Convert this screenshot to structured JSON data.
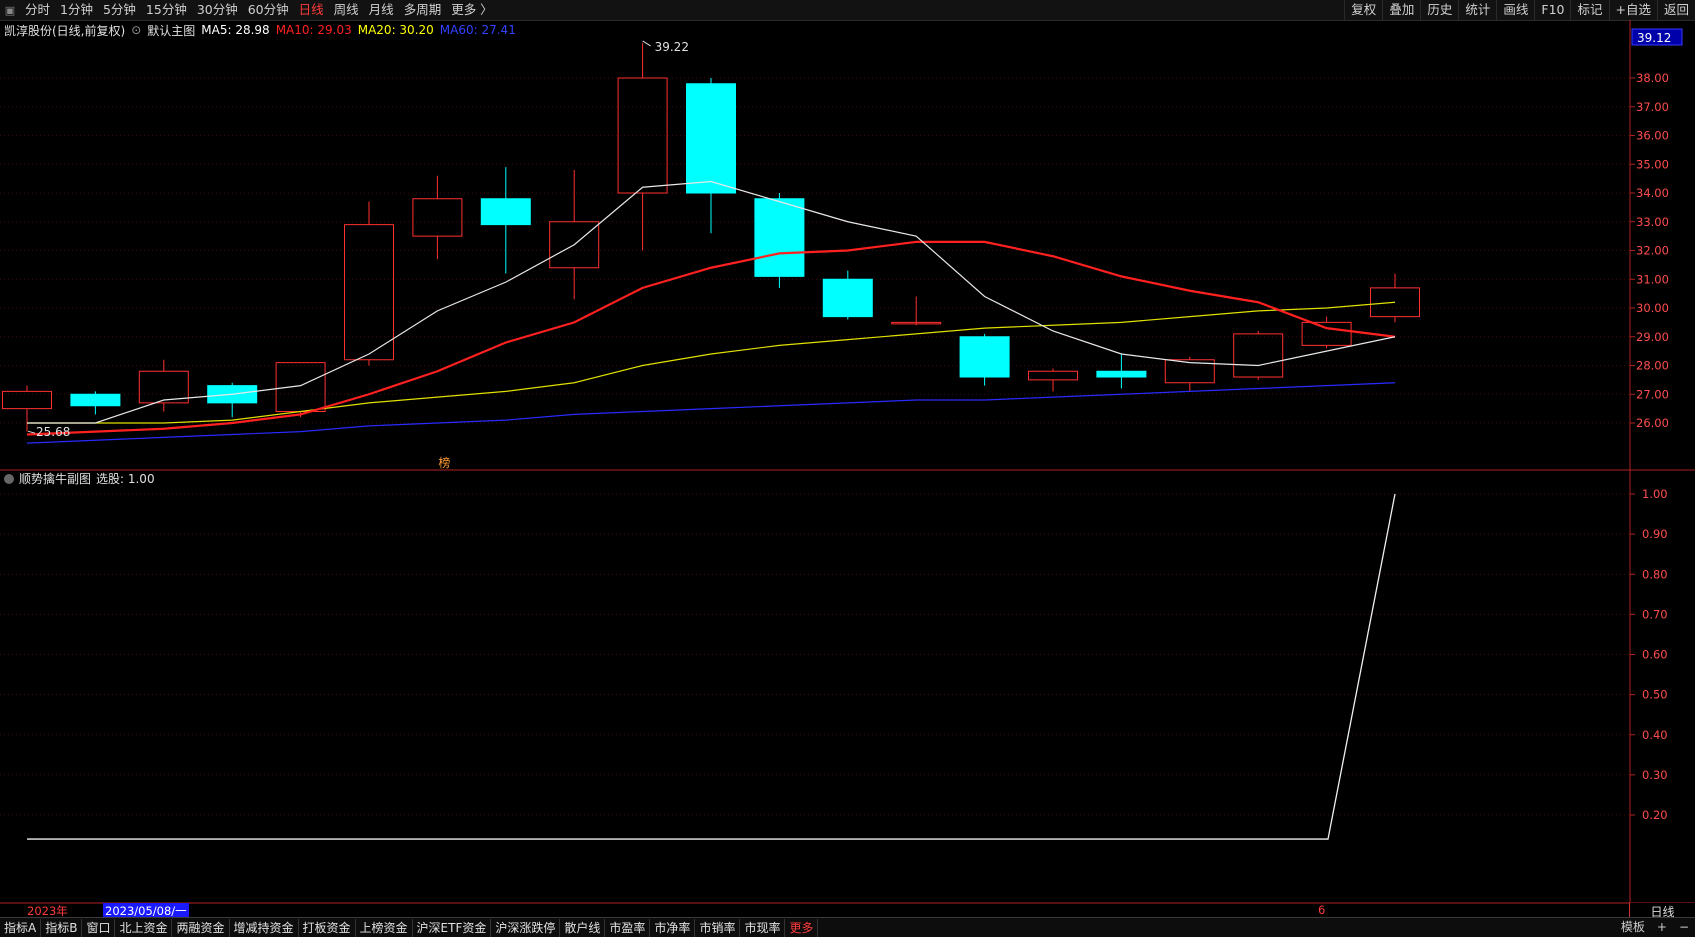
{
  "toolbar": {
    "menu_icon": "menu-icon",
    "periods": [
      "分时",
      "1分钟",
      "5分钟",
      "15分钟",
      "30分钟",
      "60分钟",
      "日线",
      "周线",
      "月线",
      "多周期",
      "更多 〉"
    ],
    "active_period": "日线",
    "right_buttons": [
      "复权",
      "叠加",
      "历史",
      "统计",
      "画线",
      "F10",
      "标记",
      "+自选",
      "返回"
    ]
  },
  "main_chart": {
    "stock_title": "凯淳股份(日线,前复权)",
    "indicator_name": "默认主图",
    "ma": [
      {
        "label": "MA5: 28.98",
        "color": "#ffffff"
      },
      {
        "label": "MA10: 29.03",
        "color": "#ff2020"
      },
      {
        "label": "MA20: 30.20",
        "color": "#ffff00"
      },
      {
        "label": "MA60: 27.41",
        "color": "#3040ff"
      }
    ],
    "current_price": "39.12",
    "high_label": "39.22",
    "low_label": "25.68",
    "flag_label": "榜",
    "price_ticks": [
      "38.00",
      "37.00",
      "36.00",
      "35.00",
      "34.00",
      "33.00",
      "32.00",
      "31.00",
      "30.00",
      "29.00",
      "28.00",
      "27.00",
      "26.00"
    ]
  },
  "sub_chart": {
    "title": "顺势擒牛副图",
    "value_label": "选股: 1.00",
    "ticks": [
      "1.00",
      "0.90",
      "0.80",
      "0.70",
      "0.60",
      "0.50",
      "0.40",
      "0.30",
      "0.20"
    ]
  },
  "chart_data": {
    "type": "candlestick",
    "price_axis": [
      25.0,
      39.5
    ],
    "candles": [
      {
        "o": 26.5,
        "h": 27.3,
        "l": 25.7,
        "c": 27.1
      },
      {
        "o": 27.0,
        "h": 27.1,
        "l": 26.3,
        "c": 26.6
      },
      {
        "o": 26.7,
        "h": 28.2,
        "l": 26.4,
        "c": 27.8
      },
      {
        "o": 27.3,
        "h": 27.4,
        "l": 26.2,
        "c": 26.7
      },
      {
        "o": 26.4,
        "h": 28.1,
        "l": 26.2,
        "c": 28.1
      },
      {
        "o": 28.2,
        "h": 33.7,
        "l": 28.0,
        "c": 32.9
      },
      {
        "o": 32.5,
        "h": 34.6,
        "l": 31.7,
        "c": 33.8
      },
      {
        "o": 33.8,
        "h": 34.9,
        "l": 31.2,
        "c": 32.9
      },
      {
        "o": 31.4,
        "h": 34.8,
        "l": 30.3,
        "c": 33.0
      },
      {
        "o": 34.0,
        "h": 39.22,
        "l": 32.0,
        "c": 38.0
      },
      {
        "o": 37.8,
        "h": 38.0,
        "l": 32.6,
        "c": 34.0
      },
      {
        "o": 33.8,
        "h": 34.0,
        "l": 30.7,
        "c": 31.1
      },
      {
        "o": 31.0,
        "h": 31.3,
        "l": 29.6,
        "c": 29.7
      },
      {
        "o": 29.5,
        "h": 30.4,
        "l": 29.4,
        "c": 29.5
      },
      {
        "o": 29.0,
        "h": 29.1,
        "l": 27.3,
        "c": 27.6
      },
      {
        "o": 27.5,
        "h": 27.9,
        "l": 27.1,
        "c": 27.8
      },
      {
        "o": 27.8,
        "h": 28.4,
        "l": 27.2,
        "c": 27.6
      },
      {
        "o": 27.4,
        "h": 28.3,
        "l": 27.1,
        "c": 28.2
      },
      {
        "o": 27.6,
        "h": 29.2,
        "l": 27.5,
        "c": 29.1
      },
      {
        "o": 28.7,
        "h": 29.7,
        "l": 28.6,
        "c": 29.5
      },
      {
        "o": 29.7,
        "h": 31.2,
        "l": 29.5,
        "c": 30.7
      }
    ],
    "ma5": [
      26.0,
      26.0,
      26.8,
      27.0,
      27.3,
      28.4,
      29.9,
      30.9,
      32.2,
      34.2,
      34.4,
      33.7,
      33.0,
      32.5,
      30.4,
      29.2,
      28.4,
      28.1,
      28.0,
      28.5,
      29.0
    ],
    "ma10": [
      25.6,
      25.7,
      25.8,
      26.0,
      26.3,
      27.0,
      27.8,
      28.8,
      29.5,
      30.7,
      31.4,
      31.9,
      32.0,
      32.3,
      32.3,
      31.8,
      31.1,
      30.6,
      30.2,
      29.3,
      29.0
    ],
    "ma20": [
      26.0,
      26.0,
      26.0,
      26.1,
      26.4,
      26.7,
      26.9,
      27.1,
      27.4,
      28.0,
      28.4,
      28.7,
      28.9,
      29.1,
      29.3,
      29.4,
      29.5,
      29.7,
      29.9,
      30.0,
      30.2
    ],
    "ma60": [
      25.3,
      25.4,
      25.5,
      25.6,
      25.7,
      25.9,
      26.0,
      26.1,
      26.3,
      26.4,
      26.5,
      26.6,
      26.7,
      26.8,
      26.8,
      26.9,
      27.0,
      27.1,
      27.2,
      27.3,
      27.4
    ],
    "signal": [
      0,
      0,
      0,
      0,
      0,
      0,
      0,
      0,
      0,
      0,
      0,
      0,
      0,
      0,
      0,
      0,
      0,
      0,
      0,
      0,
      1.0
    ],
    "signal_axis": [
      0.1,
      1.05
    ]
  },
  "date_axis": {
    "year_label": "2023年",
    "cursor_date": "2023/05/08/一",
    "tick_label": "6",
    "period_label": "日线"
  },
  "bottom_tabs": [
    "指标A",
    "指标B",
    "窗口",
    "北上资金",
    "两融资金",
    "增减持资金",
    "打板资金",
    "上榜资金",
    "沪深ETF资金",
    "沪深涨跌停",
    "散户线",
    "市盈率",
    "市净率",
    "市销率",
    "市现率",
    "更多"
  ],
  "bottom_right": [
    "模板",
    "+",
    "−"
  ],
  "colors": {
    "up": "#ff3030",
    "down": "#00ffff",
    "axis": "#b02020"
  }
}
